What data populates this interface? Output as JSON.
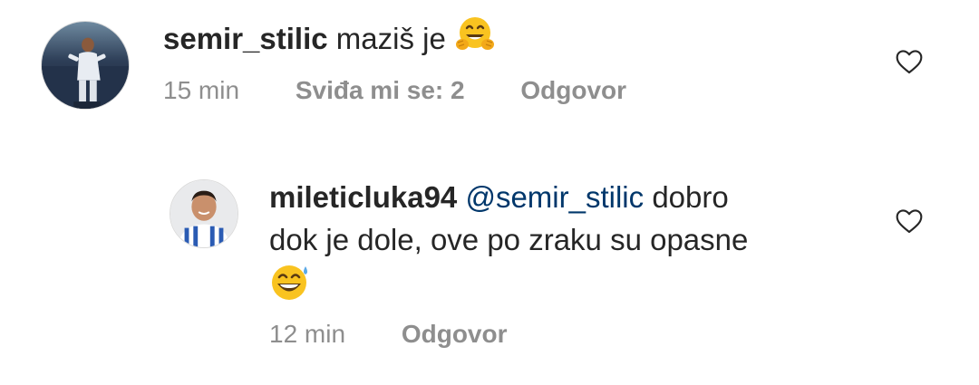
{
  "comments": [
    {
      "username": "semir_stilic",
      "text": "maziš je",
      "emoji": "hugging-face-emoji",
      "time": "15 min",
      "likes": "Sviđa mi se: 2",
      "reply": "Odgovor"
    },
    {
      "username": "mileticluka94",
      "mention": "@semir_stilic",
      "text_part1": "dobro",
      "text_line2": "dok je dole, ove po zraku su opasne",
      "emoji": "grinning-face-with-sweat-emoji",
      "time": "12 min",
      "reply": "Odgovor"
    }
  ],
  "colors": {
    "text": "#262626",
    "secondary": "#8e8e8e",
    "mention": "#00376b",
    "background": "#ffffff"
  }
}
